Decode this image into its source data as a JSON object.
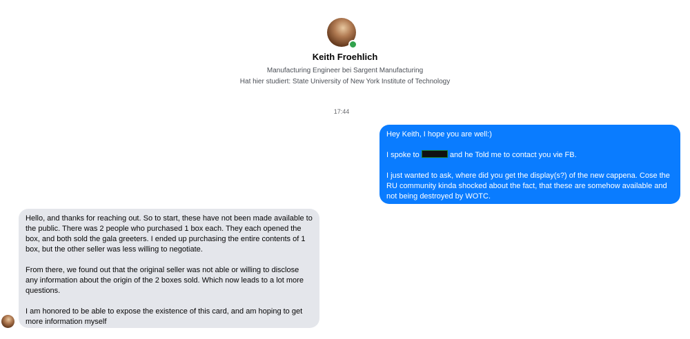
{
  "profile": {
    "name": "Keith Froehlich",
    "occupation": "Manufacturing Engineer bei Sargent Manufacturing",
    "education": "Hat hier studiert: State University of New York Institute of Technology",
    "online": true
  },
  "timestamp": "17:44",
  "messages": {
    "outgoing": {
      "line1": "Hey Keith, I hope you are well:)",
      "line2_before": "I spoke to ",
      "line2_after": " and he Told me to contact you vie FB.",
      "line3": "I just wanted to ask, where did you get the display(s?) of the new cappena. Cose the RU community kinda shocked about the fact, that these are somehow available and not being destroyed by WOTC."
    },
    "incoming": {
      "p1": "Hello, and thanks for reaching out. So to start, these have not been made available to the public. There was 2 people who purchased 1 box each. They each opened the box, and both sold the gala greeters. I ended up purchasing the entire contents of 1 box, but the other seller was less willing to negotiate.",
      "p2": "From there, we found out that the original seller was not able or willing to disclose any information about the origin of the 2 boxes sold. Which now leads to a lot more questions.",
      "p3": "I am honored to be able to expose the existence of this card, and am hoping to get more information myself"
    }
  },
  "colors": {
    "outgoing_bubble": "#0a7cff",
    "incoming_bubble": "#e4e6eb",
    "online_indicator": "#31a24c"
  }
}
